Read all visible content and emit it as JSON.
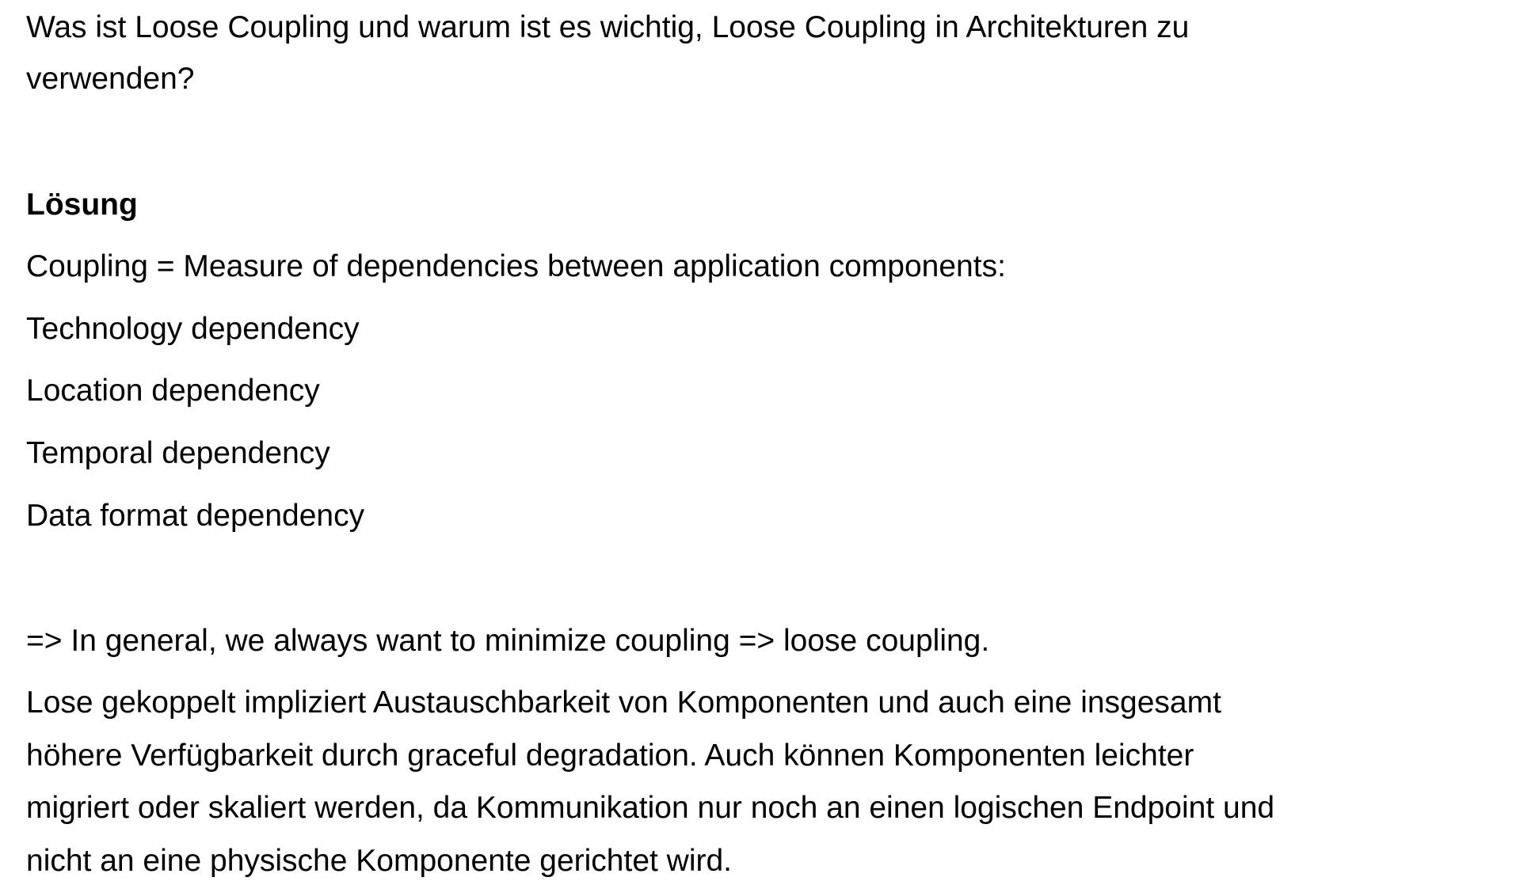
{
  "question": {
    "lines": [
      "Was ist Loose Coupling und warum ist es wichtig, Loose Coupling in Architekturen zu",
      "verwenden?"
    ]
  },
  "solution": {
    "heading": "Lösung",
    "definition": "Coupling = Measure of dependencies between application components:",
    "dependencies": [
      "Technology dependency",
      "Location dependency",
      "Temporal dependency",
      "Data format dependency"
    ],
    "conclusion": "=> In general, we always want to minimize coupling => loose coupling.",
    "explanation_lines": [
      "Lose gekoppelt impliziert Austauschbarkeit von Komponenten und auch eine insgesamt",
      "höhere Verfügbarkeit durch graceful degradation. Auch können Komponenten leichter",
      "migriert oder skaliert werden, da Kommunikation nur noch an einen logischen Endpoint und",
      "nicht an eine physische Komponente gerichtet wird."
    ]
  }
}
